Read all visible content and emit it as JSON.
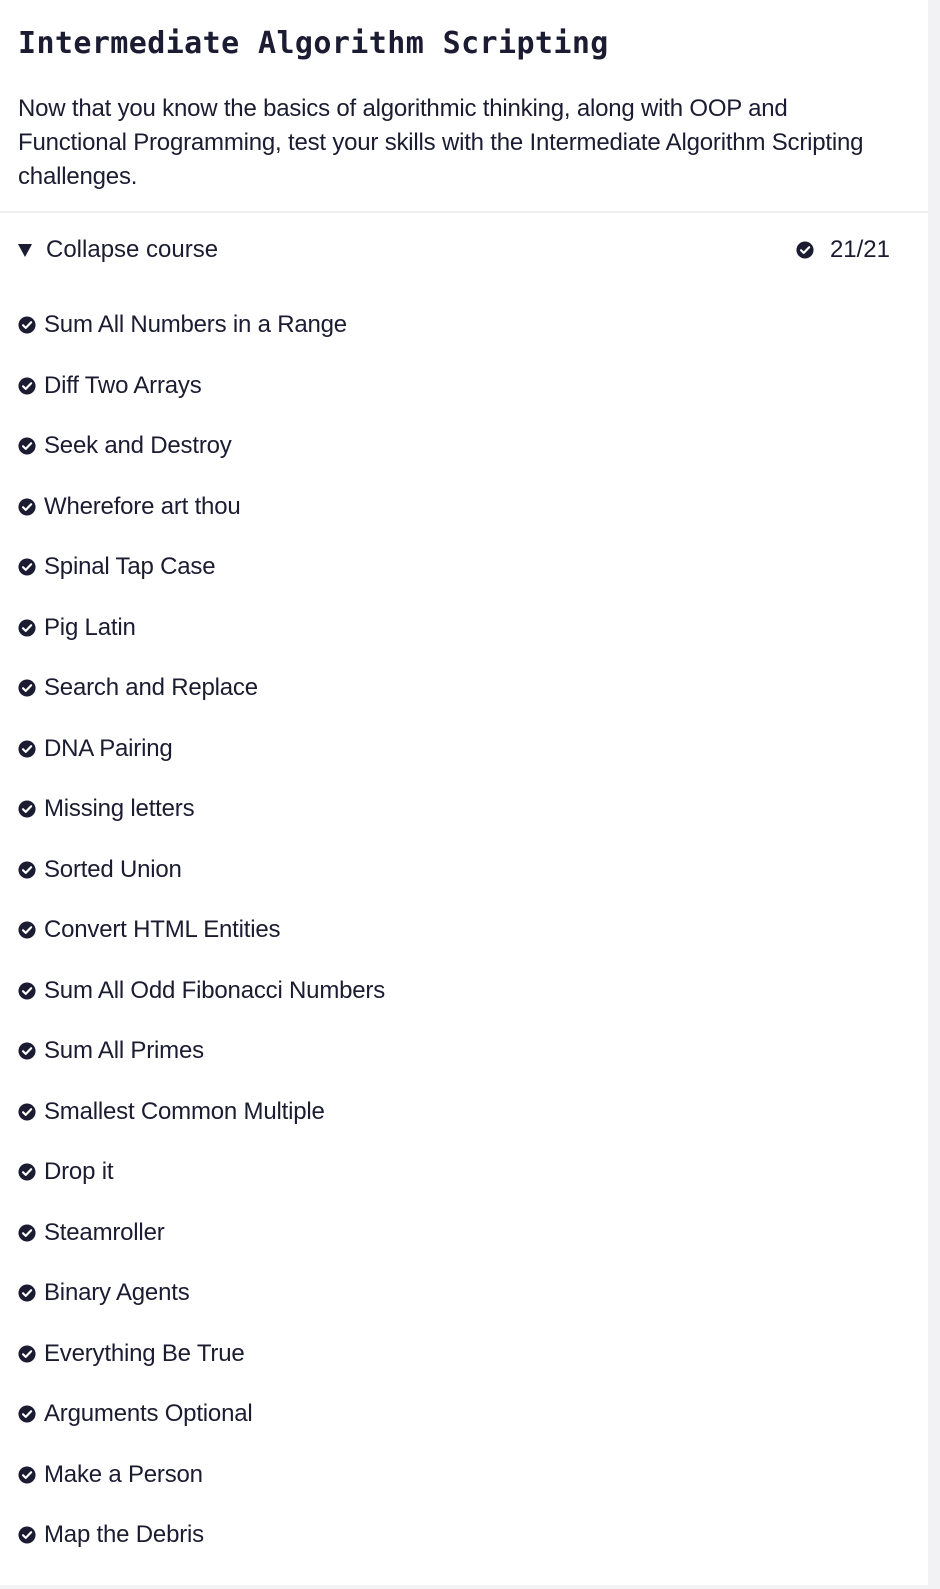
{
  "section": {
    "title": "Intermediate Algorithm Scripting",
    "description": "Now that you know the basics of algorithmic thinking, along with OOP and Functional Programming, test your skills with the Intermediate Algorithm Scripting challenges."
  },
  "course": {
    "collapse_label": "Collapse course",
    "collapse_icon": "triangle-down-icon",
    "progress": "21/21",
    "progress_icon": "check-circle-icon"
  },
  "challenges": [
    {
      "label": "Sum All Numbers in a Range",
      "icon": "check-circle-icon"
    },
    {
      "label": "Diff Two Arrays",
      "icon": "check-circle-icon"
    },
    {
      "label": "Seek and Destroy",
      "icon": "check-circle-icon"
    },
    {
      "label": "Wherefore art thou",
      "icon": "check-circle-icon"
    },
    {
      "label": "Spinal Tap Case",
      "icon": "check-circle-icon"
    },
    {
      "label": "Pig Latin",
      "icon": "check-circle-icon"
    },
    {
      "label": "Search and Replace",
      "icon": "check-circle-icon"
    },
    {
      "label": "DNA Pairing",
      "icon": "check-circle-icon"
    },
    {
      "label": "Missing letters",
      "icon": "check-circle-icon"
    },
    {
      "label": "Sorted Union",
      "icon": "check-circle-icon"
    },
    {
      "label": "Convert HTML Entities",
      "icon": "check-circle-icon"
    },
    {
      "label": "Sum All Odd Fibonacci Numbers",
      "icon": "check-circle-icon"
    },
    {
      "label": "Sum All Primes",
      "icon": "check-circle-icon"
    },
    {
      "label": "Smallest Common Multiple",
      "icon": "check-circle-icon"
    },
    {
      "label": "Drop it",
      "icon": "check-circle-icon"
    },
    {
      "label": "Steamroller",
      "icon": "check-circle-icon"
    },
    {
      "label": "Binary Agents",
      "icon": "check-circle-icon"
    },
    {
      "label": "Everything Be True",
      "icon": "check-circle-icon"
    },
    {
      "label": "Arguments Optional",
      "icon": "check-circle-icon"
    },
    {
      "label": "Make a Person",
      "icon": "check-circle-icon"
    },
    {
      "label": "Map the Debris",
      "icon": "check-circle-icon"
    }
  ],
  "colors": {
    "text": "#1b1b32",
    "background": "#ffffff",
    "page": "#f2f2f4"
  }
}
